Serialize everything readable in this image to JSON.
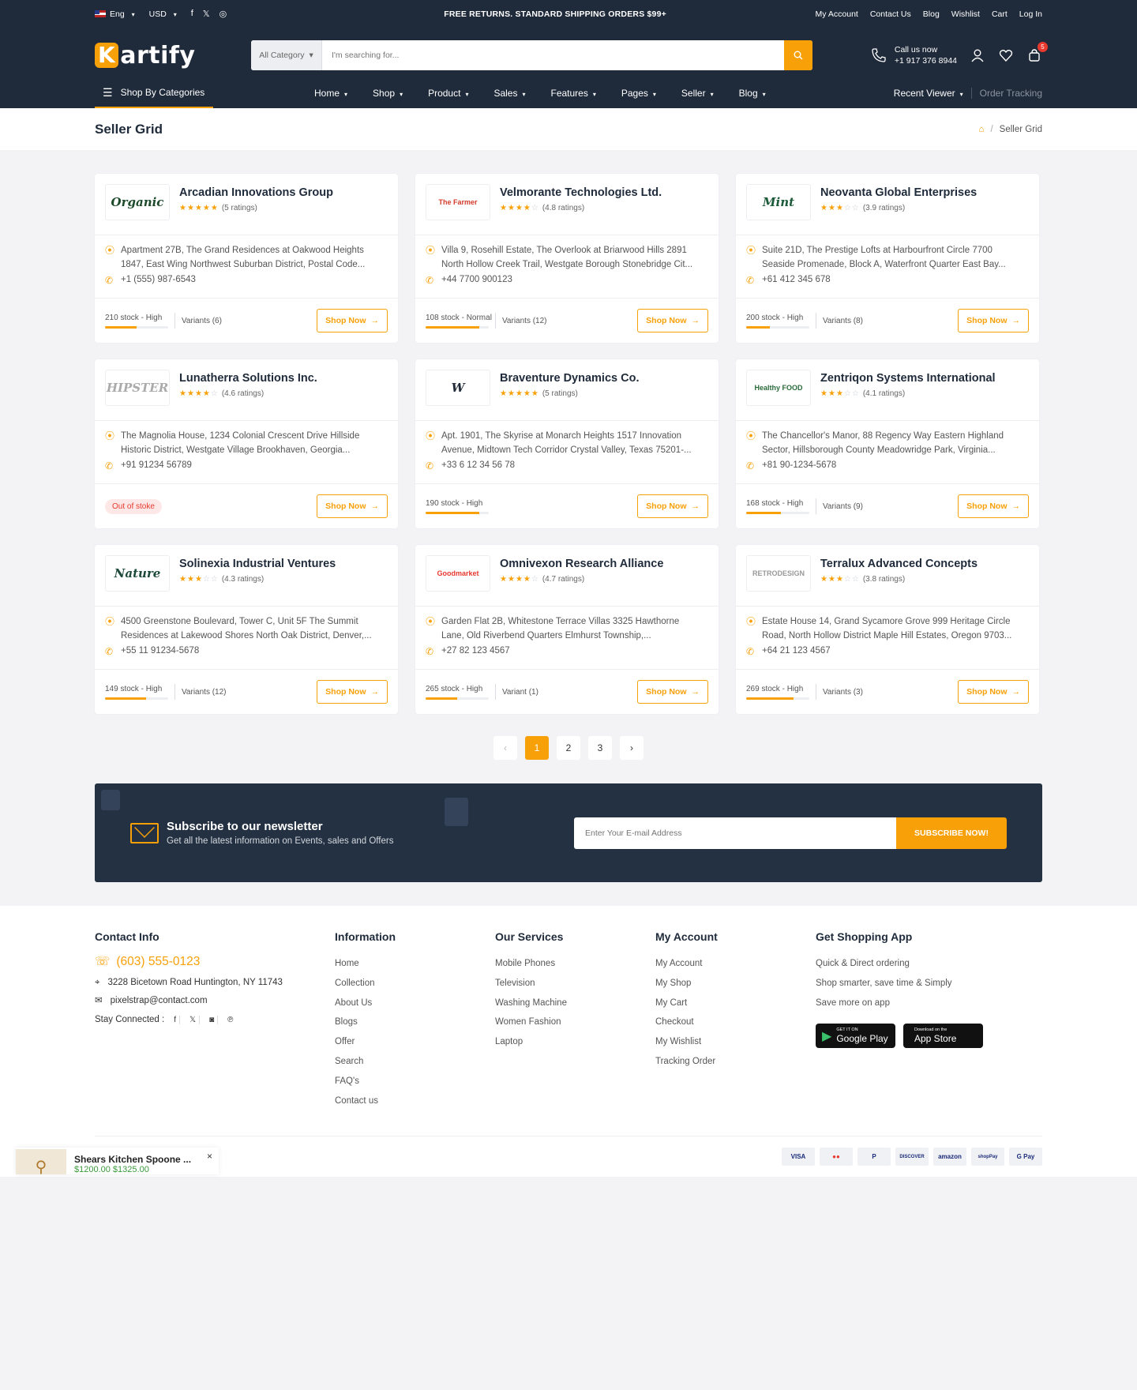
{
  "topbar": {
    "lang": "Eng",
    "currency": "USD",
    "promo": "FREE RETURNS. STANDARD SHIPPING ORDERS $99+",
    "links": [
      "My Account",
      "Contact Us",
      "Blog",
      "Wishlist",
      "Cart",
      "Log In"
    ]
  },
  "header": {
    "logo_rest": "artify",
    "logo_k": "K",
    "search_category": "All Category",
    "search_placeholder": "I'm searching for...",
    "call_label": "Call us now",
    "call_number": "+1 917 376 8944",
    "cart_count": "5"
  },
  "nav": {
    "shop_by": "Shop By Categories",
    "menu": [
      "Home",
      "Shop",
      "Product",
      "Sales",
      "Features",
      "Pages",
      "Seller",
      "Blog"
    ],
    "recent": "Recent Viewer",
    "order_tracking": "Order Tracking"
  },
  "page": {
    "title": "Seller Grid",
    "crumb": "Seller Grid"
  },
  "sellers": [
    {
      "logo": "Organic",
      "logo_color": "#1d4a2a",
      "name": "Arcadian Innovations Group",
      "stars": 5,
      "ratings": "(5 ratings)",
      "address": "Apartment 27B, The Grand Residences at Oakwood Heights 1847, East Wing Northwest Suburban District, Postal Code...",
      "phone": "+1 (555) 987-6543",
      "stock": "210 stock - High",
      "fill": 0.5,
      "variants": "Variants (6)",
      "oos": false
    },
    {
      "logo": "The Farmer",
      "logo_color": "#d43a2a",
      "name": "Velmorante Technologies Ltd.",
      "stars": 4,
      "ratings": "(4.8 ratings)",
      "address": "Villa 9, Rosehill Estate, The Overlook at Briarwood Hills 2891 North Hollow Creek Trail, Westgate Borough Stonebridge Cit...",
      "phone": "+44 7700 900123",
      "stock": "108 stock - Normal",
      "fill": 0.85,
      "variants": "Variants (12)",
      "oos": false
    },
    {
      "logo": "Mint",
      "logo_color": "#1d5a3a",
      "name": "Neovanta Global Enterprises",
      "stars": 3,
      "ratings": "(3.9 ratings)",
      "address": "Suite 21D, The Prestige Lofts at Harbourfront Circle 7700 Seaside Promenade, Block A, Waterfront Quarter East Bay...",
      "phone": "+61 412 345 678",
      "stock": "200 stock - High",
      "fill": 0.38,
      "variants": "Variants (8)",
      "oos": false
    },
    {
      "logo": "HIPSTER",
      "logo_color": "#aaaaaa",
      "name": "Lunatherra Solutions Inc.",
      "stars": 4,
      "ratings": "(4.6 ratings)",
      "address": "The Magnolia House, 1234 Colonial Crescent Drive Hillside Historic District, Westgate Village Brookhaven, Georgia...",
      "phone": "+91 91234 56789",
      "stock": "",
      "fill": 0,
      "variants": "",
      "oos": true,
      "oos_label": "Out of stoke"
    },
    {
      "logo": "W",
      "logo_color": "#222b38",
      "name": "Braventure Dynamics Co.",
      "stars": 5,
      "ratings": "(5 ratings)",
      "address": "Apt. 1901, The Skyrise at Monarch Heights 1517 Innovation Avenue, Midtown Tech Corridor Crystal Valley, Texas 75201-...",
      "phone": "+33 6 12 34 56 78",
      "stock": "190 stock - High",
      "fill": 0.85,
      "variants": "",
      "oos": false
    },
    {
      "logo": "Healthy FOOD",
      "logo_color": "#2a6a3a",
      "name": "Zentriqon Systems International",
      "stars": 3,
      "ratings": "(4.1 ratings)",
      "address": "The Chancellor's Manor, 88 Regency Way Eastern Highland Sector, Hillsborough County Meadowridge Park, Virginia...",
      "phone": "+81 90-1234-5678",
      "stock": "168 stock - High",
      "fill": 0.55,
      "variants": "Variants (9)",
      "oos": false
    },
    {
      "logo": "Nature",
      "logo_color": "#1d4a3a",
      "name": "Solinexia Industrial Ventures",
      "stars": 3,
      "ratings": "(4.3 ratings)",
      "address": "4500 Greenstone Boulevard, Tower C, Unit 5F The Summit Residences at Lakewood Shores North Oak District, Denver,...",
      "phone": "+55 11 91234-5678",
      "stock": "149 stock - High",
      "fill": 0.65,
      "variants": "Variants (12)",
      "oos": false
    },
    {
      "logo": "Goodmarket",
      "logo_color": "#e8392f",
      "name": "Omnivexon Research Alliance",
      "stars": 4,
      "ratings": "(4.7 ratings)",
      "address": "Garden Flat 2B, Whitestone Terrace Villas 3325 Hawthorne Lane, Old Riverbend Quarters Elmhurst Township,...",
      "phone": "+27 82 123 4567",
      "stock": "265 stock - High",
      "fill": 0.5,
      "variants": "Variant (1)",
      "oos": false
    },
    {
      "logo": "RETRODESIGN",
      "logo_color": "#999999",
      "name": "Terralux Advanced Concepts",
      "stars": 3,
      "ratings": "(3.8 ratings)",
      "address": "Estate House 14, Grand Sycamore Grove 999 Heritage Circle Road, North Hollow District Maple Hill Estates, Oregon 9703...",
      "phone": "+64 21 123 4567",
      "stock": "269 stock - High",
      "fill": 0.75,
      "variants": "Variants (3)",
      "oos": false
    }
  ],
  "shop_now": "Shop Now",
  "pagination": [
    "‹",
    "1",
    "2",
    "3",
    "›"
  ],
  "newsletter": {
    "title": "Subscribe to our newsletter",
    "subtitle": "Get all the latest information on Events, sales and Offers",
    "placeholder": "Enter Your E-mail Address",
    "button": "SUBSCRIBE NOW!"
  },
  "footer": {
    "contact": {
      "title": "Contact Info",
      "phone": "(603) 555-0123",
      "address": "3228 Bicetown Road Huntington, NY 11743",
      "email": "pixelstrap@contact.com",
      "stay": "Stay Connected :"
    },
    "information": {
      "title": "Information",
      "items": [
        "Home",
        "Collection",
        "About Us",
        "Blogs",
        "Offer",
        "Search",
        "FAQ's",
        "Contact us"
      ]
    },
    "services": {
      "title": "Our Services",
      "items": [
        "Mobile Phones",
        "Television",
        "Washing Machine",
        "Women Fashion",
        "Laptop"
      ]
    },
    "account": {
      "title": "My Account",
      "items": [
        "My Account",
        "My Shop",
        "My Cart",
        "Checkout",
        "My Wishlist",
        "Tracking Order"
      ]
    },
    "app": {
      "title": "Get Shopping App",
      "items": [
        "Quick & Direct ordering",
        "Shop smarter, save time & Simply",
        "Save more on app"
      ],
      "gp_small": "GET IT ON",
      "gp_big": "Google Play",
      "as_small": "Download on the",
      "as_big": "App Store"
    },
    "payments": [
      "VISA",
      "●●",
      "P",
      "DISCOVER",
      "amazon",
      "shopPay",
      "G Pay"
    ]
  },
  "popup": {
    "title": "Shears Kitchen Spoone ...",
    "price": "$1200.00 $1325.00",
    "close": "×"
  },
  "colors": {
    "accent": "#f7a008",
    "dark": "#1f2a3a",
    "danger": "#e8392f"
  }
}
